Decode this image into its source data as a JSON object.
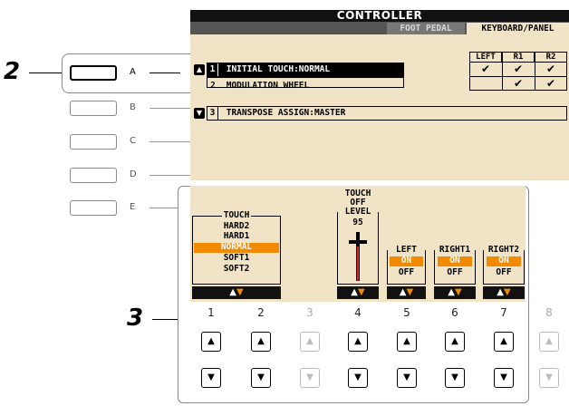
{
  "steps": {
    "step2": "2",
    "step3": "3"
  },
  "side_buttons": [
    {
      "label": "A",
      "active": true
    },
    {
      "label": "B",
      "active": false
    },
    {
      "label": "C",
      "active": false
    },
    {
      "label": "D",
      "active": false
    },
    {
      "label": "E",
      "active": false
    }
  ],
  "screen": {
    "title": "CONTROLLER",
    "tabs": [
      "FOOT PEDAL",
      "KEYBOARD/PANEL"
    ],
    "active_tab": "KEYBOARD/PANEL",
    "column_headers": [
      "LEFT",
      "R1",
      "R2"
    ],
    "rows": [
      {
        "index": "1",
        "label": "INITIAL TOUCH:NORMAL",
        "selected": true,
        "checks": [
          "✔",
          "✔",
          "✔"
        ]
      },
      {
        "index": "2",
        "label": "MODULATION WHEEL",
        "selected": false,
        "checks": [
          "",
          "✔",
          "✔"
        ]
      },
      {
        "index": "3",
        "label": "TRANSPOSE ASSIGN:MASTER",
        "selected": false,
        "checks": []
      }
    ]
  },
  "lower": {
    "touch": {
      "title": "TOUCH",
      "options": [
        "HARD2",
        "HARD1",
        "NORMAL",
        "SOFT1",
        "SOFT2"
      ],
      "selected": "NORMAL"
    },
    "touch_off": {
      "line1": "TOUCH",
      "line2": "OFF",
      "line3": "LEVEL",
      "value": "95"
    },
    "parts": [
      {
        "title": "LEFT",
        "on": "ON",
        "off": "OFF"
      },
      {
        "title": "RIGHT1",
        "on": "ON",
        "off": "OFF"
      },
      {
        "title": "RIGHT2",
        "on": "ON",
        "off": "OFF"
      }
    ],
    "arrows": "▲▼",
    "columns": [
      "1",
      "2",
      "3",
      "4",
      "5",
      "6",
      "7",
      "8"
    ],
    "up_symbol": "▲",
    "down_symbol": "▼"
  },
  "colors": {
    "screen_bg": "#f0e3c6",
    "highlight": "#f28a00",
    "dark": "#111111"
  }
}
